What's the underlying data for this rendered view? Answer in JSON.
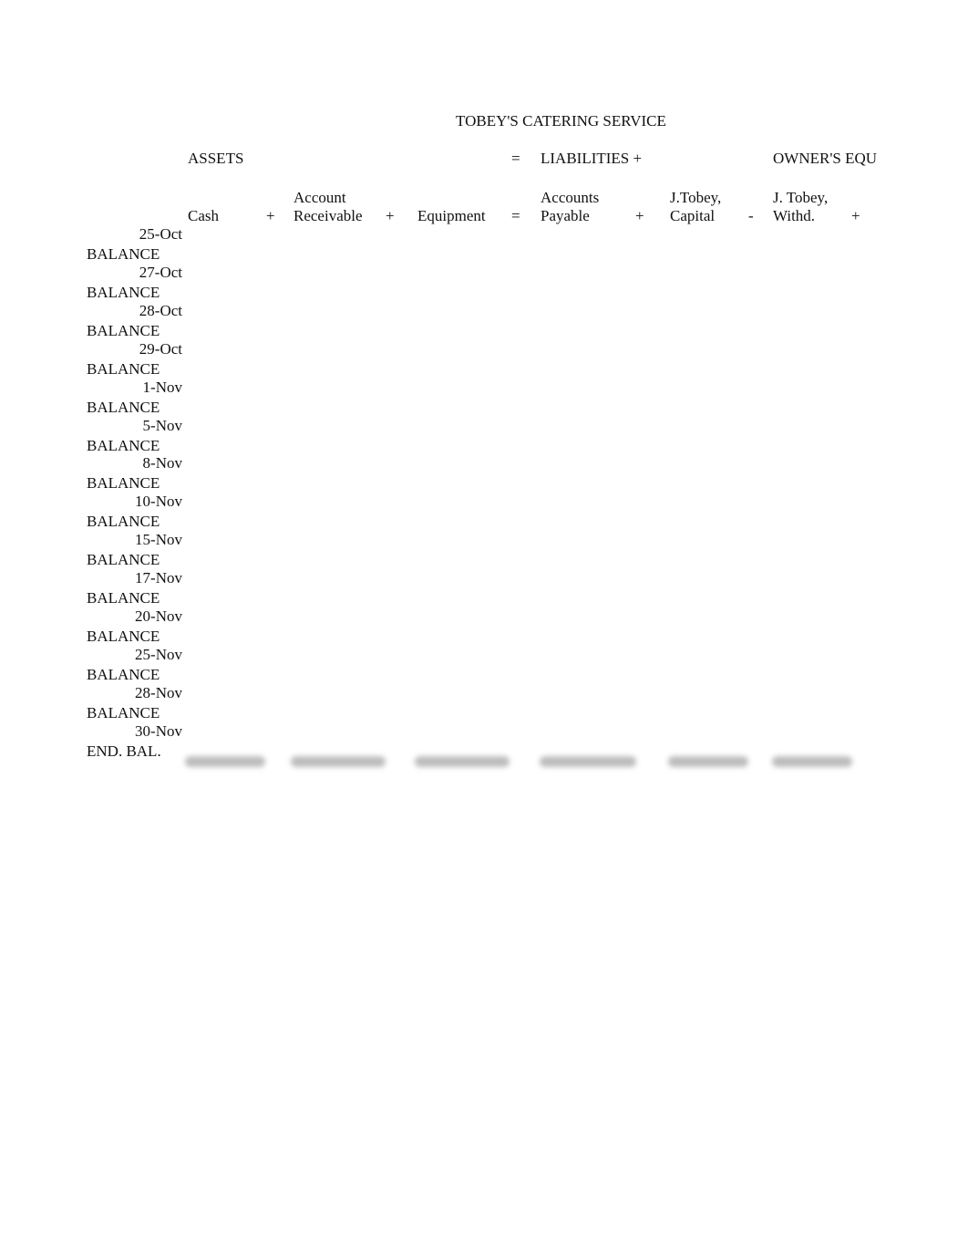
{
  "title": "TOBEY'S CATERING SERVICE",
  "sections": {
    "assets": "ASSETS",
    "eq1": "=",
    "liabilities": "LIABILITIES +",
    "owners_equity": "OWNER'S EQU"
  },
  "columns": {
    "cash": "Cash",
    "plus1": "+",
    "ar_line1": "Account",
    "ar_line2": "Receivable",
    "plus2": "+",
    "equipment": "Equipment",
    "eq2": "=",
    "ap_line1": "Accounts",
    "ap_line2": "Payable",
    "plus3": "+",
    "cap_line1": "J.Tobey,",
    "cap_line2": "Capital",
    "minus": "-",
    "wd_line1": "J. Tobey,",
    "wd_line2": "Withd.",
    "plus4": "+"
  },
  "rows": [
    {
      "date": "25-Oct",
      "label": "BALANCE"
    },
    {
      "date": "27-Oct",
      "label": "BALANCE"
    },
    {
      "date": "28-Oct",
      "label": "BALANCE"
    },
    {
      "date": "29-Oct",
      "label": "BALANCE"
    },
    {
      "date": "1-Nov",
      "label": "BALANCE"
    },
    {
      "date": "5-Nov",
      "label": "BALANCE"
    },
    {
      "date": "8-Nov",
      "label": "BALANCE"
    },
    {
      "date": "10-Nov",
      "label": "BALANCE"
    },
    {
      "date": "15-Nov",
      "label": "BALANCE"
    },
    {
      "date": "17-Nov",
      "label": "BALANCE"
    },
    {
      "date": "20-Nov",
      "label": "BALANCE"
    },
    {
      "date": "25-Nov",
      "label": "BALANCE"
    },
    {
      "date": "28-Nov",
      "label": "BALANCE"
    },
    {
      "date": "30-Nov",
      "label": "END. BAL."
    }
  ]
}
